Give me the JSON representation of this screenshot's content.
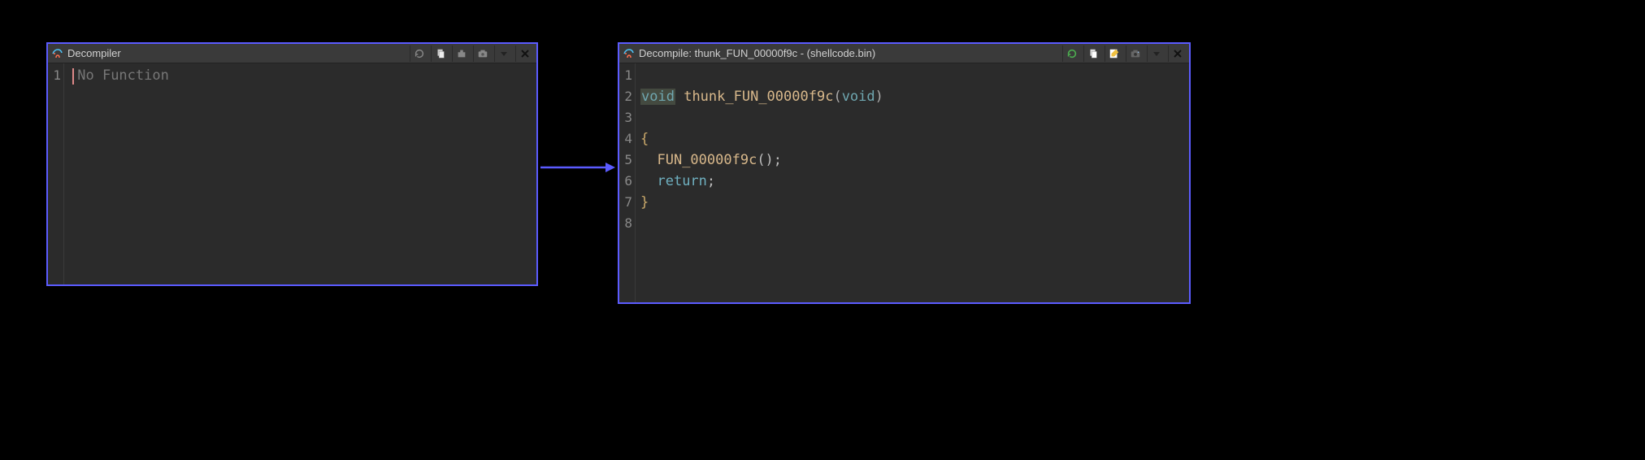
{
  "left_panel": {
    "title": "Decompiler",
    "lines": [
      {
        "num": "1",
        "segments": [
          {
            "text": "No Function",
            "cls": "tok-comment"
          }
        ],
        "cursor": true
      }
    ]
  },
  "right_panel": {
    "title": "Decompile: thunk_FUN_00000f9c -  (shellcode.bin)",
    "lines": [
      {
        "num": "1",
        "segments": []
      },
      {
        "num": "2",
        "segments": [
          {
            "text": "void",
            "cls": "tok-type sel-highlight"
          },
          {
            "text": " ",
            "cls": "tok-plain"
          },
          {
            "text": "thunk_FUN_00000f9c",
            "cls": "tok-func"
          },
          {
            "text": "(",
            "cls": "tok-paren"
          },
          {
            "text": "void",
            "cls": "tok-type"
          },
          {
            "text": ")",
            "cls": "tok-paren"
          }
        ]
      },
      {
        "num": "3",
        "segments": []
      },
      {
        "num": "4",
        "segments": [
          {
            "text": "{",
            "cls": "tok-brace"
          }
        ]
      },
      {
        "num": "5",
        "segments": [
          {
            "text": "  ",
            "cls": "tok-plain"
          },
          {
            "text": "FUN_00000f9c",
            "cls": "tok-func"
          },
          {
            "text": "();",
            "cls": "tok-plain"
          }
        ]
      },
      {
        "num": "6",
        "segments": [
          {
            "text": "  ",
            "cls": "tok-plain"
          },
          {
            "text": "return",
            "cls": "tok-keyword"
          },
          {
            "text": ";",
            "cls": "tok-plain"
          }
        ]
      },
      {
        "num": "7",
        "segments": [
          {
            "text": "}",
            "cls": "tok-brace"
          }
        ]
      },
      {
        "num": "8",
        "segments": []
      }
    ]
  }
}
